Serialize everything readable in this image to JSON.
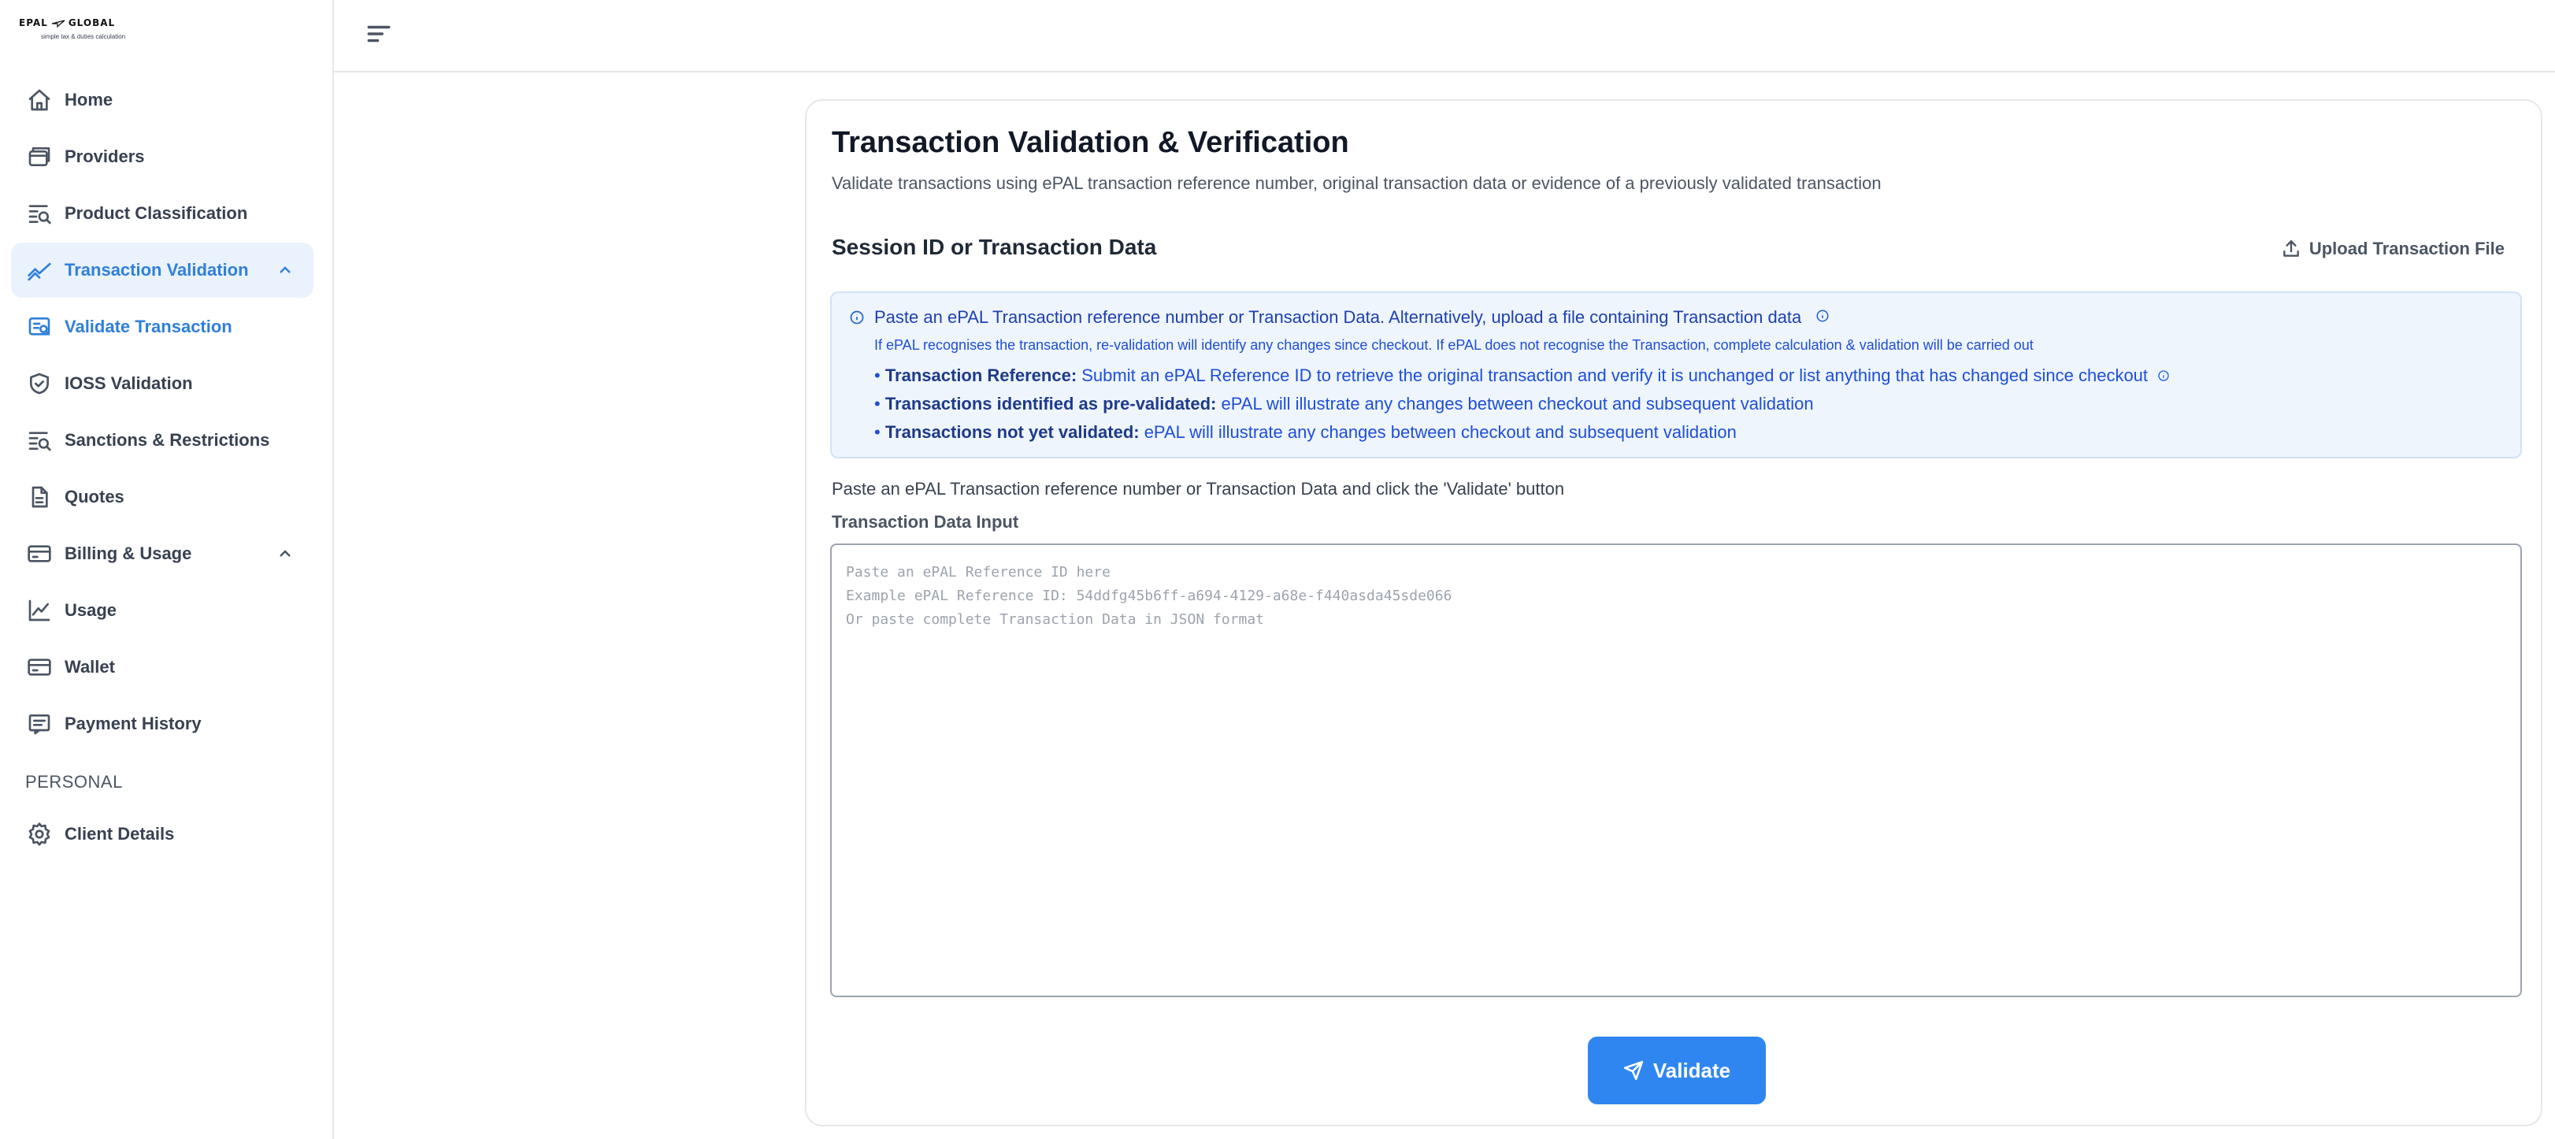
{
  "brand": {
    "name_left": "EPAL",
    "name_right": "GLOBAL",
    "tagline": "simple tax & duties calculation"
  },
  "sidebar": {
    "items": [
      {
        "label": "Home",
        "icon": "home-icon"
      },
      {
        "label": "Providers",
        "icon": "providers-icon"
      },
      {
        "label": "Product Classification",
        "icon": "classification-icon"
      },
      {
        "label": "Transaction Validation",
        "icon": "trend-icon",
        "expanded": true,
        "active": true
      },
      {
        "label": "Validate Transaction",
        "icon": "validate-doc-icon",
        "selected": true
      },
      {
        "label": "IOSS Validation",
        "icon": "shield-check-icon"
      },
      {
        "label": "Sanctions & Restrictions",
        "icon": "list-search-icon"
      },
      {
        "label": "Quotes",
        "icon": "document-icon"
      },
      {
        "label": "Billing & Usage",
        "icon": "card-icon",
        "expanded": true
      },
      {
        "label": "Usage",
        "icon": "chart-line-icon"
      },
      {
        "label": "Wallet",
        "icon": "wallet-icon"
      },
      {
        "label": "Payment History",
        "icon": "receipt-icon"
      },
      {
        "label": "Client Details",
        "icon": "gear-icon"
      }
    ],
    "section_personal": "PERSONAL"
  },
  "main": {
    "title": "Transaction Validation & Verification",
    "subtitle": "Validate transactions using ePAL transaction reference number, original transaction data or evidence of a previously validated transaction",
    "section_title": "Session ID or Transaction Data",
    "upload_label": "Upload Transaction File",
    "info": {
      "headline": "Paste an ePAL Transaction reference number or Transaction Data. Alternatively, upload a file containing Transaction data",
      "note": "If ePAL recognises the transaction, re-validation will identify any changes since checkout. If ePAL does not recognise the Transaction, complete calculation & validation will be carried out",
      "bullets": [
        {
          "bold": "Transaction Reference:",
          "text": " Submit an ePAL Reference ID to retrieve the original transaction and verify it is unchanged or list anything that has changed since checkout"
        },
        {
          "bold": "Transactions identified as pre-validated:",
          "text": " ePAL will illustrate any changes between checkout and subsequent validation"
        },
        {
          "bold": "Transactions not yet validated:",
          "text": " ePAL will illustrate any changes between checkout and subsequent validation"
        }
      ]
    },
    "instruction": "Paste an ePAL Transaction reference number or Transaction Data and click the 'Validate' button",
    "field_label": "Transaction Data Input",
    "placeholder_lines": [
      "Paste an ePAL Reference ID here",
      "Example ePAL Reference ID: 54ddfg45b6ff-a694-4129-a68e-f440asda45sde066",
      "Or paste complete Transaction Data in JSON format"
    ],
    "validate_label": "Validate"
  },
  "colors": {
    "accent": "#2f86f0",
    "active_bg": "#eaf2fd",
    "info_bg": "#eef5fd",
    "info_text": "#1d4ed8"
  }
}
